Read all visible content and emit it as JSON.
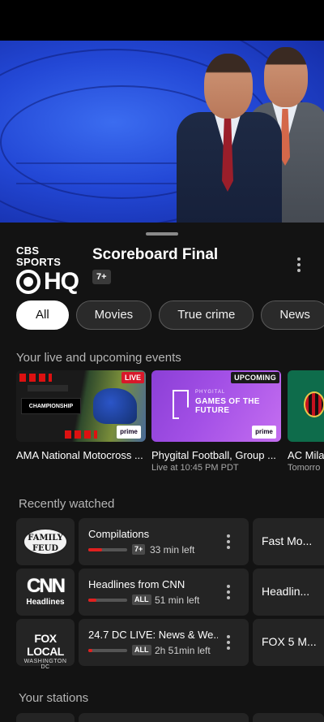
{
  "channel": {
    "logo_top": "CBS SPORTS",
    "logo_bottom": "HQ",
    "show_title": "Scoreboard Final",
    "rating": "7+"
  },
  "filters": {
    "chips": [
      "All",
      "Movies",
      "True crime",
      "News"
    ],
    "selected": "All"
  },
  "live_section": {
    "title": "Your live and upcoming events",
    "events": [
      {
        "title": "AMA National Motocross ...",
        "subtitle": "",
        "badge": "LIVE",
        "thumb_text": "CHAMPIONSHIP",
        "tag": "prime"
      },
      {
        "title": "Phygital Football, Group ...",
        "subtitle": "Live at 10:45 PM PDT",
        "badge": "UPCOMING",
        "thumb_text_top": "PHYGITAL",
        "thumb_text_main": "GAMES OF THE FUTURE",
        "tag": "prime"
      },
      {
        "title": "AC Mila",
        "subtitle": "Tomorro"
      }
    ]
  },
  "recently_watched": {
    "title": "Recently watched",
    "items": [
      {
        "logo_text": "FAMILY FEUD",
        "title": "Compilations",
        "rating": "7+",
        "time_left": "33 min left",
        "progress": 0.35,
        "next_title": "Fast Mo..."
      },
      {
        "logo_text": "CNN",
        "logo_sub": "Headlines",
        "title": "Headlines from CNN",
        "rating": "ALL",
        "time_left": "51 min left",
        "progress": 0.2,
        "next_title": "Headlin..."
      },
      {
        "logo_text": "FOX LOCAL",
        "logo_sub": "WASHINGTON DC",
        "title": "24.7 DC LIVE: News & We...",
        "rating": "ALL",
        "time_left": "2h 51min left",
        "progress": 0.1,
        "next_title": "FOX 5 M..."
      }
    ]
  },
  "stations": {
    "title": "Your stations"
  },
  "colors": {
    "accent_red": "#e0201f",
    "background": "#131313",
    "card": "#242424"
  }
}
